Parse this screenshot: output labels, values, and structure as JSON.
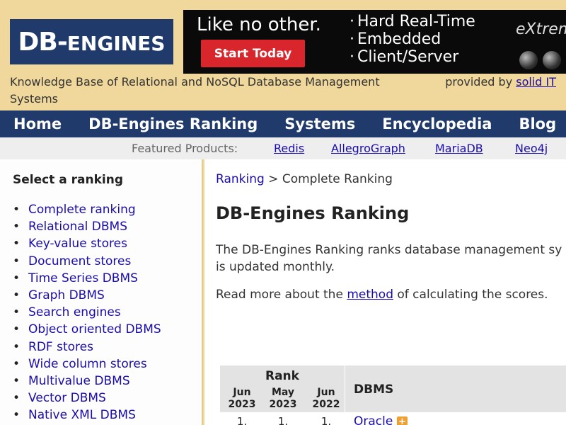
{
  "header": {
    "logo_main": "DB-",
    "logo_tail": "ENGINES",
    "tagline": "Knowledge Base of Relational and NoSQL Database Management Systems",
    "provided_prefix": "provided by",
    "provided_link": "solid IT"
  },
  "ad": {
    "headline": "Like no other.",
    "cta": "Start Today",
    "features": [
      "Hard Real-Time",
      "Embedded",
      "Client/Server"
    ],
    "brand": "eXtrem"
  },
  "nav": {
    "items": [
      "Home",
      "DB-Engines Ranking",
      "Systems",
      "Encyclopedia",
      "Blog"
    ]
  },
  "featured": {
    "label": "Featured Products:",
    "products": [
      "Redis",
      "AllegroGraph",
      "MariaDB",
      "Neo4j"
    ]
  },
  "sidebar": {
    "title": "Select a ranking",
    "items": [
      "Complete ranking",
      "Relational DBMS",
      "Key-value stores",
      "Document stores",
      "Time Series DBMS",
      "Graph DBMS",
      "Search engines",
      "Object oriented DBMS",
      "RDF stores",
      "Wide column stores",
      "Multivalue DBMS",
      "Vector DBMS",
      "Native XML DBMS"
    ]
  },
  "main": {
    "breadcrumb_link": "Ranking",
    "breadcrumb_sep": ">",
    "breadcrumb_current": "Complete Ranking",
    "title": "DB-Engines Ranking",
    "intro": "The DB-Engines Ranking ranks database management sy ranking is updated monthly.",
    "readmore_prefix": "Read more about the",
    "readmore_link": "method",
    "readmore_suffix": "of calculating the scores."
  },
  "table": {
    "rank_header": "Rank",
    "periods": [
      {
        "month": "Jun",
        "year": "2023"
      },
      {
        "month": "May",
        "year": "2023"
      },
      {
        "month": "Jun",
        "year": "2022"
      }
    ],
    "dbms_header": "DBMS",
    "first_row": {
      "ranks": [
        "1.",
        "1.",
        "1."
      ],
      "name": "Oracle",
      "plus": "+"
    }
  },
  "colors": {
    "background": "#f0d89c",
    "nav": "#1f3a6b",
    "link": "#1a0dab",
    "ad_cta": "#d9262c"
  }
}
